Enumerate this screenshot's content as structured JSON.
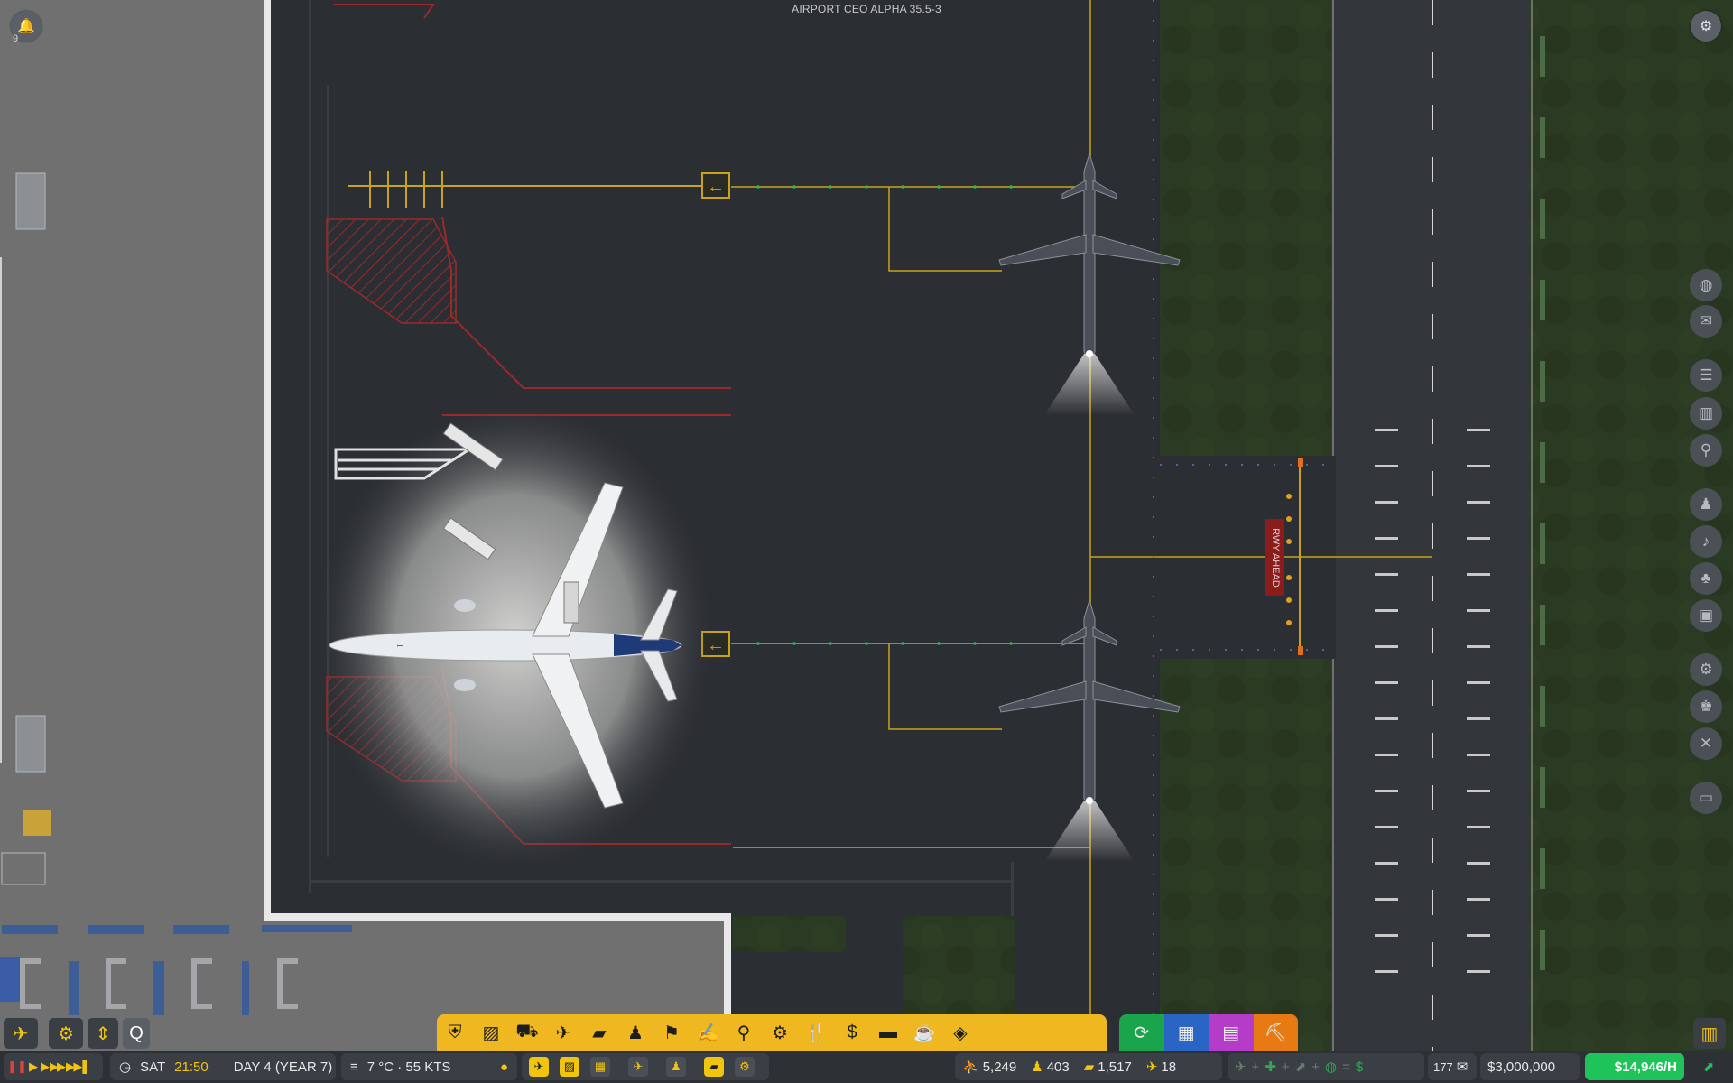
{
  "app": {
    "build_label": "AIRPORT CEO ALPHA 35.5-3"
  },
  "notifications": {
    "icon": "bell-icon",
    "count": "9"
  },
  "settings": {
    "icon": "gear-icon"
  },
  "map": {
    "runway_sign": "RWY AHEAD",
    "colors": {
      "apron": "#2b2e33",
      "grass": "#2a3a20",
      "taxi_line": "#c9a31a",
      "runway": "#33363b",
      "hold_lines": "#a52b2b"
    }
  },
  "time": {
    "speed_buttons": [
      "pause-icon",
      "play-icon",
      "fast-icon",
      "faster-icon",
      "fastest-icon"
    ],
    "day": "SAT",
    "clock": "21:50",
    "date": "DAY 4 (YEAR 7)"
  },
  "weather": {
    "icon": "wind-icon",
    "text": "7 °C · 55 KTS"
  },
  "toolbar": {
    "build_tools": [
      "gate-tool-icon",
      "runway-tool-icon",
      "bus-tool-icon",
      "aircraft-tool-icon",
      "baggage-tool-icon",
      "staff-tool-icon",
      "security-tool-icon",
      "checkin-tool-icon",
      "toilet-tool-icon",
      "conveyor-tool-icon",
      "food-tool-icon",
      "money-tool-icon",
      "seating-tool-icon",
      "retail-tool-icon",
      "layers-tool-icon"
    ],
    "overlay_tools": [
      "refresh-overlay-icon",
      "grid-overlay-icon",
      "zones-overlay-icon",
      "bulldoze-overlay-icon"
    ]
  },
  "stats": {
    "passengers": "5,249",
    "staff": "403",
    "bags": "1,517",
    "flights": "18",
    "mail": "177",
    "balance": "$3,000,000",
    "income": "$14,946/H"
  },
  "quick_tools": [
    "plane-tool-icon",
    "zone-tool-icon",
    "grid-tool-icon",
    "runway-plane-icon",
    "person-tool-icon",
    "bag-tool-icon",
    "conveyor-small-icon"
  ],
  "right_panel": [
    "globe-icon",
    "mail-icon",
    "report-icon",
    "chart-icon",
    "search-chart-icon",
    "person-icon",
    "bell-icon",
    "people-icon",
    "car-icon",
    "gear-icon",
    "staff-icon",
    "tools-icon",
    "computer-icon"
  ]
}
